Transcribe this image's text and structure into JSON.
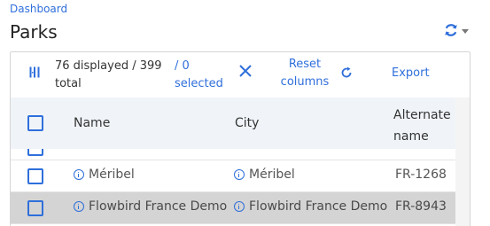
{
  "breadcrumb": "Dashboard",
  "title": "Parks",
  "toolbar": {
    "count_text": "76 displayed / 399 total",
    "selected_text": "/ 0 selected",
    "reset_label": "Reset columns",
    "export_label": "Export"
  },
  "table": {
    "headers": {
      "name": "Name",
      "city": "City",
      "alternate": "Alternate name"
    },
    "rows": [
      {
        "name": "Méribel",
        "city": "Méribel",
        "alternate": "FR-1268",
        "highlighted": false
      },
      {
        "name": "Flowbird France Demo",
        "city": "Flowbird France Demo",
        "alternate": "FR-8943",
        "highlighted": true
      }
    ]
  },
  "colors": {
    "accent": "#2f6fdb",
    "header_bg": "#f0f4f9",
    "row_highlight": "#d4d4d4"
  },
  "icons": [
    "sync-icon",
    "chevron-down-icon",
    "columns-icon",
    "close-icon",
    "reset-icon",
    "info-icon"
  ]
}
